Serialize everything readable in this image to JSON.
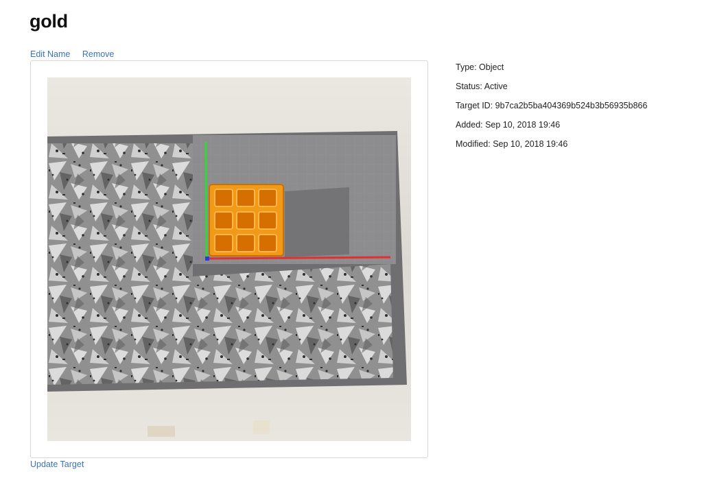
{
  "page": {
    "title": "gold"
  },
  "actions": {
    "edit_name": "Edit Name",
    "remove": "Remove"
  },
  "image": {
    "subject": "orange 3x3 grid object on textured target sheet with axis overlay"
  },
  "footer": {
    "update_target": "Update Target"
  },
  "details": {
    "type": "Type: Object",
    "status": "Status: Active",
    "target_id": "Target ID: 9b7ca2b5ba404369b524b3b56935b866",
    "added": "Added: Sep 10, 2018 19:46",
    "modified": "Modified: Sep 10, 2018 19:46"
  },
  "colors": {
    "link": "#3b73b3",
    "object": "#f39a1c",
    "axis_x": "#e23030",
    "axis_y": "#39d439",
    "axis_z": "#2b3ccf"
  }
}
